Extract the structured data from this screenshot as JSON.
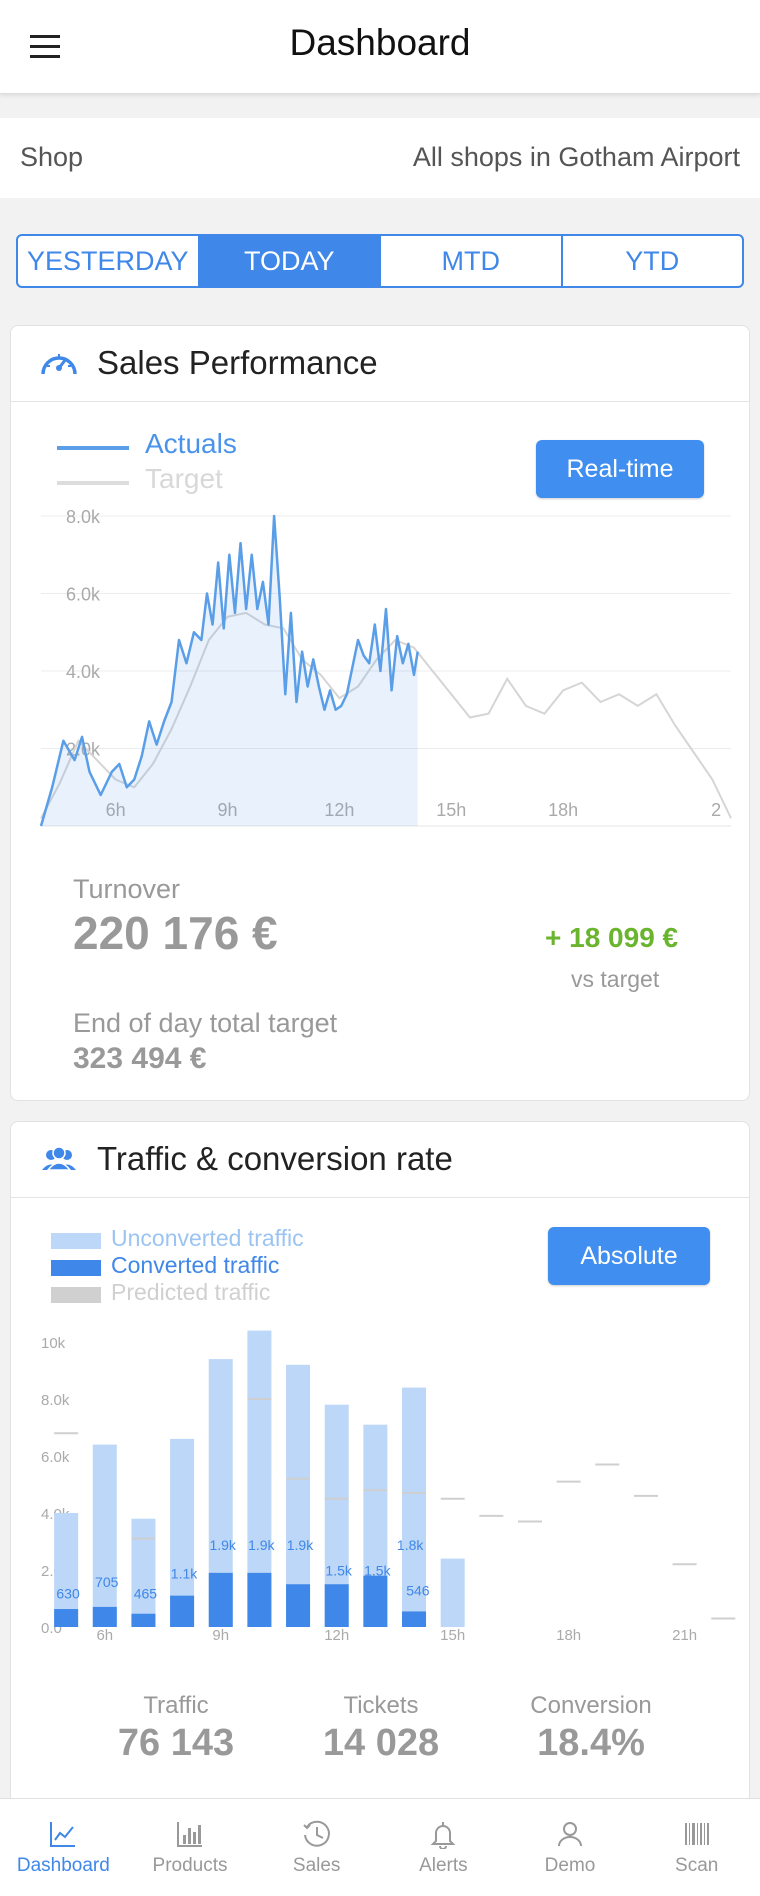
{
  "header": {
    "title": "Dashboard",
    "menu_icon": "hamburger-menu-icon"
  },
  "shop": {
    "label": "Shop",
    "value": "All shops in Gotham Airport"
  },
  "periods": [
    {
      "label": "YESTERDAY",
      "active": false
    },
    {
      "label": "TODAY",
      "active": true
    },
    {
      "label": "MTD",
      "active": false
    },
    {
      "label": "YTD",
      "active": false
    }
  ],
  "sales": {
    "title": "Sales Performance",
    "icon": "speedometer-icon",
    "legend_actuals": "Actuals",
    "legend_target": "Target",
    "mode_button": "Real-time",
    "turnover_label": "Turnover",
    "turnover_value": "220 176 €",
    "vs_target_value": "+ 18 099 €",
    "vs_target_label": "vs target",
    "eod_label": "End of day total target",
    "eod_value": "323 494 €",
    "colors": {
      "actuals": "#5a9ee8",
      "target": "#d5d5d5",
      "positive": "#6ab42e"
    }
  },
  "traffic": {
    "title": "Traffic & conversion rate",
    "icon": "people-icon",
    "legend_unconverted": "Unconverted traffic",
    "legend_converted": "Converted traffic",
    "legend_predicted": "Predicted traffic",
    "mode_button": "Absolute",
    "stats": [
      {
        "label": "Traffic",
        "value": "76 143"
      },
      {
        "label": "Tickets",
        "value": "14 028"
      },
      {
        "label": "Conversion",
        "value": "18.4%"
      }
    ],
    "colors": {
      "unconverted": "#bcd7f7",
      "converted": "#3f87e8",
      "predicted": "#cccccc"
    }
  },
  "tabbar": [
    {
      "label": "Dashboard",
      "icon": "line-chart-icon",
      "active": true
    },
    {
      "label": "Products",
      "icon": "bar-chart-icon",
      "active": false
    },
    {
      "label": "Sales",
      "icon": "clock-icon",
      "active": false
    },
    {
      "label": "Alerts",
      "icon": "bell-icon",
      "active": false
    },
    {
      "label": "Demo",
      "icon": "user-icon",
      "active": false
    },
    {
      "label": "Scan",
      "icon": "barcode-icon",
      "active": false
    }
  ],
  "chart_data": [
    {
      "type": "area",
      "title": "",
      "x_ticks": [
        "6h",
        "9h",
        "12h",
        "15h",
        "18h",
        "2"
      ],
      "y_ticks": [
        "2.0k",
        "4.0k",
        "6.0k",
        "8.0k"
      ],
      "ylim": [
        0,
        8000
      ],
      "xlim": [
        4.0,
        22.5
      ],
      "grid": true,
      "legend": "top-left",
      "series": [
        {
          "name": "Actuals",
          "x": [
            4.0,
            4.3,
            4.6,
            4.9,
            5.1,
            5.3,
            5.6,
            5.9,
            6.1,
            6.3,
            6.5,
            6.7,
            6.9,
            7.1,
            7.3,
            7.5,
            7.7,
            7.9,
            8.1,
            8.3,
            8.45,
            8.6,
            8.75,
            8.9,
            9.05,
            9.2,
            9.35,
            9.5,
            9.65,
            9.8,
            9.95,
            10.1,
            10.25,
            10.4,
            10.55,
            10.7,
            10.85,
            11.0,
            11.15,
            11.3,
            11.45,
            11.6,
            11.75,
            11.9,
            12.05,
            12.2,
            12.35,
            12.5,
            12.65,
            12.8,
            12.95,
            13.1,
            13.25,
            13.4,
            13.55,
            13.7,
            13.85,
            14.0,
            14.1
          ],
          "y": [
            0,
            1000,
            2200,
            1700,
            2300,
            1400,
            800,
            1400,
            1600,
            1000,
            1200,
            1800,
            2700,
            2100,
            2700,
            3200,
            4800,
            4200,
            5000,
            4800,
            6000,
            5200,
            6800,
            5100,
            7000,
            5500,
            7300,
            5600,
            7000,
            5600,
            6300,
            5200,
            8000,
            5900,
            3400,
            5500,
            3200,
            4500,
            3600,
            4300,
            3600,
            3000,
            3500,
            3000,
            3100,
            3400,
            4100,
            4800,
            4400,
            4200,
            5200,
            4000,
            5600,
            3500,
            4900,
            4200,
            4700,
            3900,
            4500
          ]
        },
        {
          "name": "Target",
          "x": [
            4.0,
            4.5,
            5.0,
            5.5,
            6.0,
            6.5,
            7.0,
            7.5,
            8.0,
            8.5,
            9.0,
            9.5,
            10.0,
            10.5,
            11.0,
            11.5,
            12.0,
            12.5,
            13.0,
            13.5,
            14.0,
            14.5,
            15.0,
            15.5,
            16.0,
            16.5,
            17.0,
            17.5,
            18.0,
            18.5,
            19.0,
            19.5,
            20.0,
            20.5,
            21.0,
            21.5,
            22.0,
            22.5
          ],
          "y": [
            200,
            1100,
            2200,
            1700,
            1200,
            1000,
            1600,
            2500,
            3600,
            4800,
            5400,
            5500,
            5200,
            5100,
            4300,
            3900,
            3300,
            3600,
            4300,
            4800,
            4600,
            4000,
            3400,
            2800,
            2900,
            3800,
            3100,
            2900,
            3500,
            3700,
            3200,
            3400,
            3100,
            3400,
            2600,
            1900,
            1200,
            200
          ]
        }
      ]
    },
    {
      "type": "bar",
      "title": "",
      "x_ticks": [
        "6h",
        "9h",
        "12h",
        "15h",
        "18h",
        "21h"
      ],
      "y_ticks": [
        "0.0",
        "2.0k",
        "4.0k",
        "6.0k",
        "8.0k",
        "10k"
      ],
      "ylim": [
        0,
        10000
      ],
      "categories": [
        5,
        6,
        7,
        8,
        9,
        10,
        11,
        12,
        13,
        14,
        15,
        16,
        17,
        18,
        19,
        20,
        21,
        22
      ],
      "series": [
        {
          "name": "Unconverted traffic",
          "values": [
            4000,
            6400,
            3800,
            6600,
            9400,
            10400,
            9200,
            7800,
            7100,
            8400,
            2400,
            null,
            null,
            null,
            null,
            null,
            null,
            null
          ]
        },
        {
          "name": "Converted traffic",
          "values": [
            630,
            705,
            465,
            1100,
            1900,
            1900,
            1500,
            1500,
            1800,
            546,
            null,
            null,
            null,
            null,
            null,
            null,
            null,
            null
          ]
        },
        {
          "name": "Predicted traffic",
          "values": [
            6800,
            null,
            3100,
            null,
            null,
            8000,
            5200,
            4500,
            4800,
            4700,
            4500,
            3900,
            3700,
            5100,
            5700,
            4600,
            2200,
            300
          ]
        }
      ],
      "bar_labels": [
        "",
        "630",
        "705",
        "465",
        "1.1k",
        "1.9k",
        "1.9k",
        "1.9k",
        "1.5k",
        "1.5k",
        "1.8k",
        "546"
      ]
    }
  ]
}
